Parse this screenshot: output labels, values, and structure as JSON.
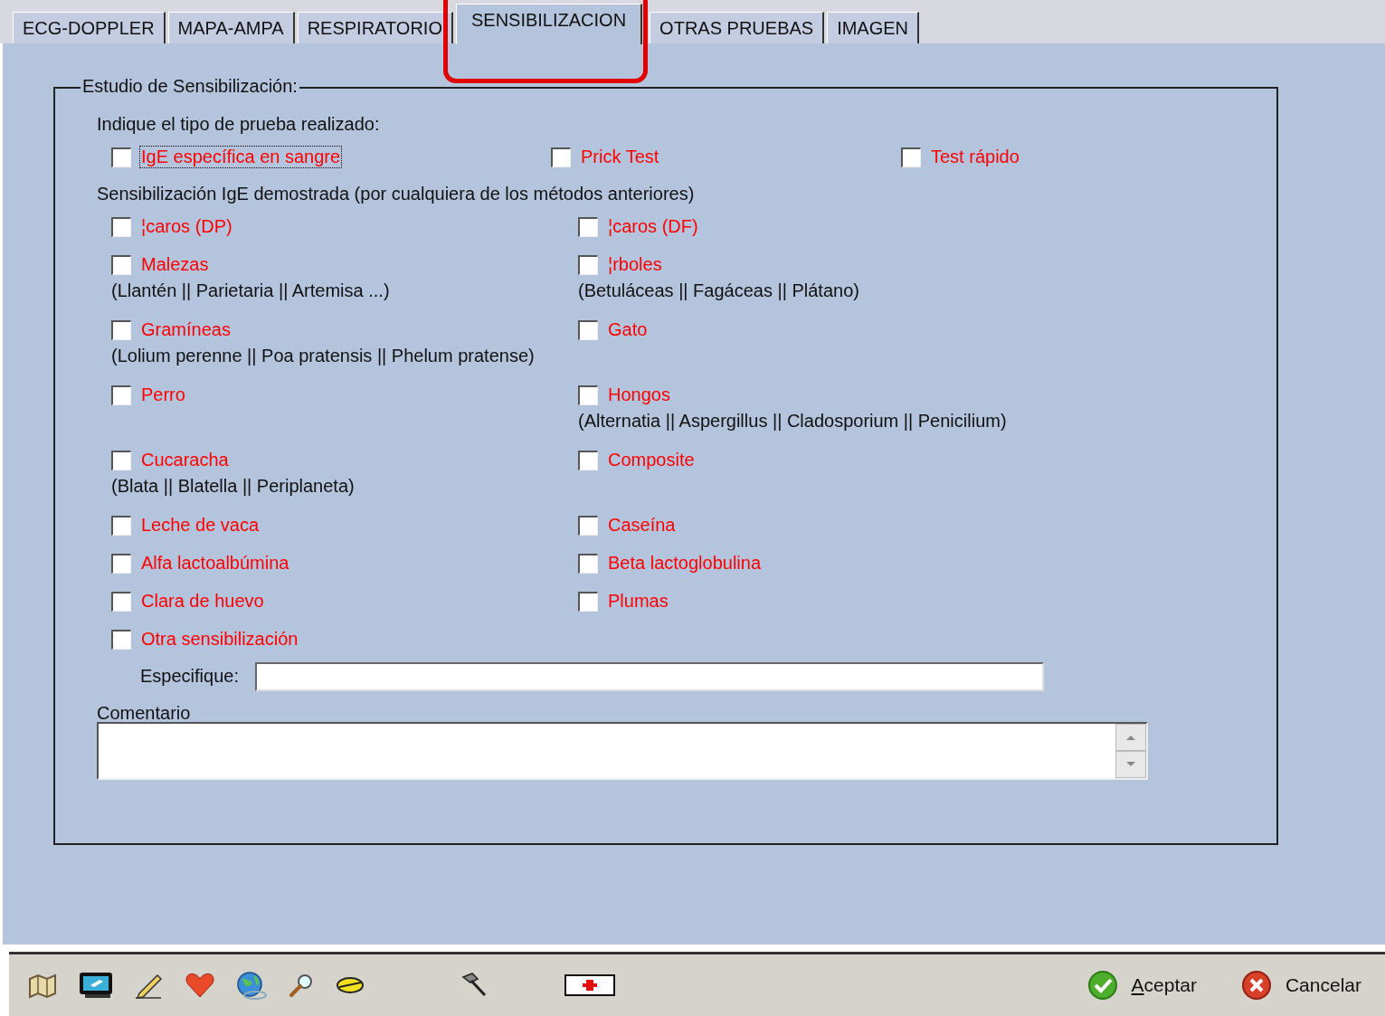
{
  "tabs": [
    {
      "label": "ECG-DOPPLER",
      "selected": false
    },
    {
      "label": "MAPA-AMPA",
      "selected": false
    },
    {
      "label": "RESPIRATORIO",
      "selected": false
    },
    {
      "label": "SENSIBILIZACION",
      "selected": true
    },
    {
      "label": "OTRAS PRUEBAS",
      "selected": false
    },
    {
      "label": "IMAGEN",
      "selected": false
    }
  ],
  "group": {
    "legend": "Estudio de Sensibilización:",
    "prompt": "Indique el tipo de prueba realizado:",
    "test_types": [
      {
        "label": "IgE específica en sangre",
        "checked": false,
        "focused": true
      },
      {
        "label": "Prick Test",
        "checked": false,
        "focused": false
      },
      {
        "label": "Test rápido",
        "checked": false,
        "focused": false
      }
    ],
    "section_label": "Sensibilización IgE demostrada (por cualquiera de los métodos anteriores)",
    "allergen_rows": [
      [
        {
          "label": "¦caros (DP)",
          "checked": false
        },
        {
          "label": "¦caros (DF)",
          "checked": false
        }
      ],
      [
        {
          "label": "Malezas",
          "checked": false,
          "note": "(Llantén || Parietaria || Artemisa ...)"
        },
        {
          "label": "¦rboles",
          "checked": false,
          "note": "(Betuláceas || Fagáceas || Plátano)"
        }
      ],
      [
        {
          "label": "Gramíneas",
          "checked": false,
          "note": "(Lolium perenne || Poa pratensis || Phelum pratense)"
        },
        {
          "label": "Gato",
          "checked": false
        }
      ],
      [
        {
          "label": "Perro",
          "checked": false
        },
        {
          "label": "Hongos",
          "checked": false,
          "note": "(Alternatia || Aspergillus || Cladosporium || Penicilium)"
        }
      ],
      [
        {
          "label": "Cucaracha",
          "checked": false,
          "note": "(Blata || Blatella || Periplaneta)"
        },
        {
          "label": "Composite",
          "checked": false
        }
      ],
      [
        {
          "label": "Leche de vaca",
          "checked": false
        },
        {
          "label": "Caseína",
          "checked": false
        }
      ],
      [
        {
          "label": "Alfa lactoalbúmina",
          "checked": false
        },
        {
          "label": "Beta lactoglobulina",
          "checked": false
        }
      ],
      [
        {
          "label": "Clara de huevo",
          "checked": false
        },
        {
          "label": "Plumas",
          "checked": false
        }
      ],
      [
        {
          "label": "Otra sensibilización",
          "checked": false
        }
      ]
    ],
    "specify_label": "Especifique:",
    "comment_label": "Comentario"
  },
  "toolbar": {
    "buttons": [
      {
        "label": "Aceptar",
        "kind": "accept"
      },
      {
        "label": "Cancelar",
        "kind": "cancel"
      }
    ]
  }
}
